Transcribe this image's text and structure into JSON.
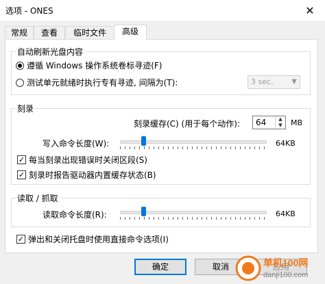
{
  "window": {
    "title": "选项 - ONES",
    "close_glyph": "✕"
  },
  "tabs": [
    {
      "label": "常规",
      "active": false
    },
    {
      "label": "查看",
      "active": false
    },
    {
      "label": "临时文件",
      "active": false
    },
    {
      "label": "高级",
      "active": true
    }
  ],
  "auto_refresh": {
    "group_label": "自动刷新光盘内容",
    "option_follow": "遵循 Windows 操作系统卷标寻迹(F)",
    "option_test": "测试单元就绪时执行专有寻迹, 间隔为(T):",
    "interval_value": "3 sec.",
    "selected": "follow"
  },
  "burn": {
    "group_label": "刻录",
    "buffer_label": "刻录缓存(C) (用于每个动作):",
    "buffer_value": "64",
    "buffer_unit": "MB",
    "write_label": "写入命令长度(W):",
    "write_value": "64KB",
    "write_level": 0.15,
    "close_on_error": "每当刻录出现错误时关闭区段(S)",
    "close_on_error_checked": true,
    "report_buffer": "刻录时报告驱动器内置缓存状态(B)",
    "report_buffer_checked": true
  },
  "read": {
    "group_label": "读取 / 抓取",
    "read_label": "读取命令长度(R):",
    "read_value": "64KB",
    "read_level": 0.15
  },
  "eject_option": "弹出和关闭托盘时使用直接命令选项(I)",
  "eject_checked": true,
  "buttons": {
    "ok": "确定",
    "cancel": "取消",
    "apply": "应用"
  },
  "watermark": {
    "site_cn": "单机100网",
    "site_url": "danji100.com"
  }
}
